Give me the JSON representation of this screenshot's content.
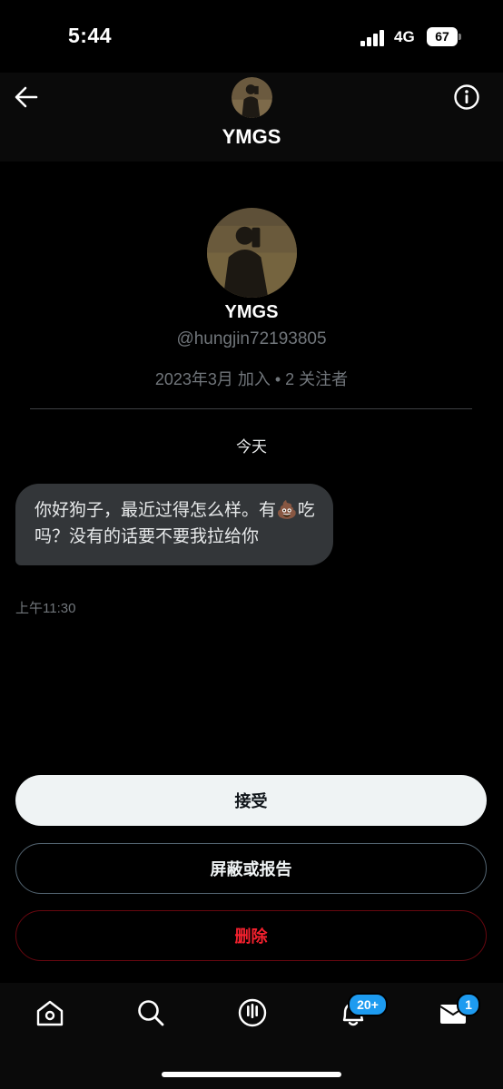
{
  "status_bar": {
    "time": "5:44",
    "network": "4G",
    "battery": "67"
  },
  "header": {
    "title": "YMGS",
    "back_icon": "arrow-left-icon",
    "info_icon": "info-circle-icon"
  },
  "profile": {
    "name": "YMGS",
    "handle": "@hungjin72193805",
    "meta": "2023年3月 加入 • 2 关注者"
  },
  "conversation": {
    "day_label": "今天",
    "messages": [
      {
        "text_part1": "你好狗子，最近过得怎么样。有",
        "emoji": "💩",
        "text_part2": "吃吗？没有的话要不要我拉给你",
        "time": "上午11:30"
      }
    ]
  },
  "actions": {
    "accept": "接受",
    "block_or_report": "屏蔽或报告",
    "delete": "删除"
  },
  "bottom_nav": {
    "items": [
      "home-icon",
      "search-icon",
      "spaces-icon",
      "notifications-icon",
      "messages-icon"
    ],
    "notifications_badge": "20+",
    "messages_badge": "1"
  },
  "colors": {
    "accent": "#1d9bf0",
    "danger": "#f4212e",
    "bubble": "#333639"
  }
}
